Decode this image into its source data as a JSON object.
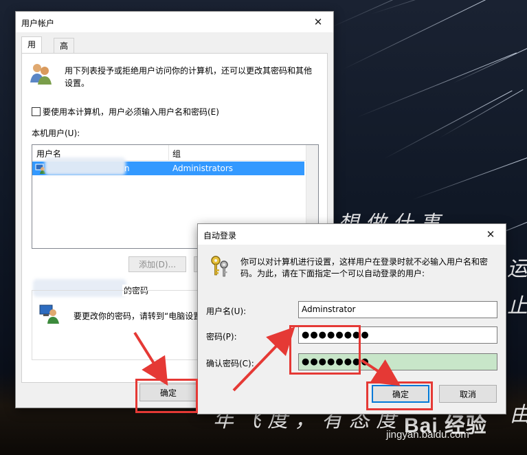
{
  "background": {
    "text_line1": "想 做 什 事",
    "text_right1": "运",
    "text_right2": "止",
    "text_line2": "年 飞 度 ， 有 态 度",
    "text_right3": "由",
    "watermark": "Bai 经验",
    "watermark_url": "jingyan.baidu.com"
  },
  "user_accounts": {
    "title": "用户帐户",
    "close_glyph": "✕",
    "tabs": [
      "用户",
      "高级"
    ],
    "intro": "用下列表授予或拒绝用户访问你的计算机，还可以更改其密码和其他设置。",
    "require_login_label": "要使用本计算机，用户必须输入用户名和密码(E)",
    "require_login_checked": false,
    "local_users_label": "本机用户(U):",
    "columns": [
      "用户名",
      "组"
    ],
    "rows": [
      {
        "username": "n",
        "group": "Administrators",
        "selected": true
      }
    ],
    "add_button": "添加(D)...",
    "password_group_suffix": "的密码",
    "password_hint": "要更改你的密码，请转到“电脑设置",
    "ok_button": "确定"
  },
  "auto_logon": {
    "title": "自动登录",
    "close_glyph": "✕",
    "description": "你可以对计算机进行设置，这样用户在登录时就不必输入用户名和密码。为此，请在下面指定一个可以自动登录的用户:",
    "username_label": "用户名(U):",
    "username_value": "Adminstrator",
    "password_label": "密码(P):",
    "password_value": "●●●●●●●●",
    "confirm_label": "确认密码(C):",
    "confirm_value": "●●●●●●●●",
    "ok_button": "确定",
    "cancel_button": "取消"
  },
  "colors": {
    "selection": "#3399ff",
    "focus_border": "#0078d7",
    "annotation_red": "#e53935",
    "confirm_field_bg": "#c8e6c9"
  }
}
